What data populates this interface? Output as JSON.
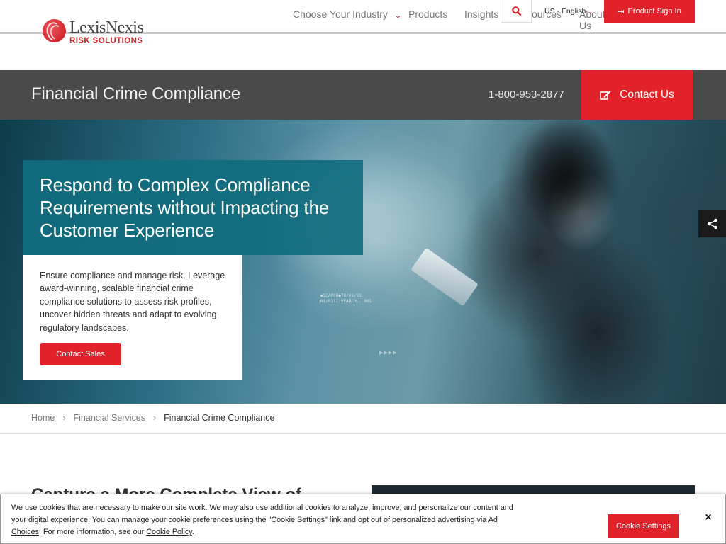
{
  "header": {
    "logo": {
      "name": "LexisNexis",
      "sub": "RISK SOLUTIONS"
    },
    "nav": {
      "industry": "Choose Your Industry",
      "products": "Products",
      "insights": "Insights",
      "resources": "sources",
      "about": "About Us"
    },
    "search_icon": "search-icon",
    "language": "US - English",
    "sign_in": "Product Sign In"
  },
  "title_bar": {
    "title": "Financial Crime Compliance",
    "phone": "1-800-953-2877",
    "contact": "Contact Us"
  },
  "hero": {
    "headline": "Respond to Complex Compliance Requirements without Impacting the Customer Experience",
    "body": "Ensure compliance and manage risk. Leverage award-winning, scalable financial crime compliance solutions to assess risk profiles, uncover hidden threats and adapt to evolving regulatory landscapes.",
    "cta": "Contact Sales",
    "hud_line1": "●SEARCH●78/01/03",
    "hud_line2": "NS/0211 SEARCH.. 001",
    "arrows": "▶▶▶▶"
  },
  "breadcrumb": {
    "home": "Home",
    "section": "Financial Services",
    "current": "Financial Crime Compliance",
    "separator": "›"
  },
  "section": {
    "heading_partial": "Capture a More Complete View of"
  },
  "cookie": {
    "text_main": "We use cookies that are necessary to make our site work. We may also use additional cookies to analyze, improve, and personalize our content and your digital experience. You can manage your cookie preferences using the \"Cookie Settings\" link and opt out of personalized advertising via ",
    "ad_choices": "Ad Choices",
    "text_mid": ". For more information, see our ",
    "policy": "Cookie Policy",
    "text_end": ".",
    "settings": "Cookie Settings",
    "close": "×"
  },
  "colors": {
    "brand_red": "#e1222b",
    "title_bar": "#4a4a4a",
    "hero_teal": "#106c7e"
  }
}
